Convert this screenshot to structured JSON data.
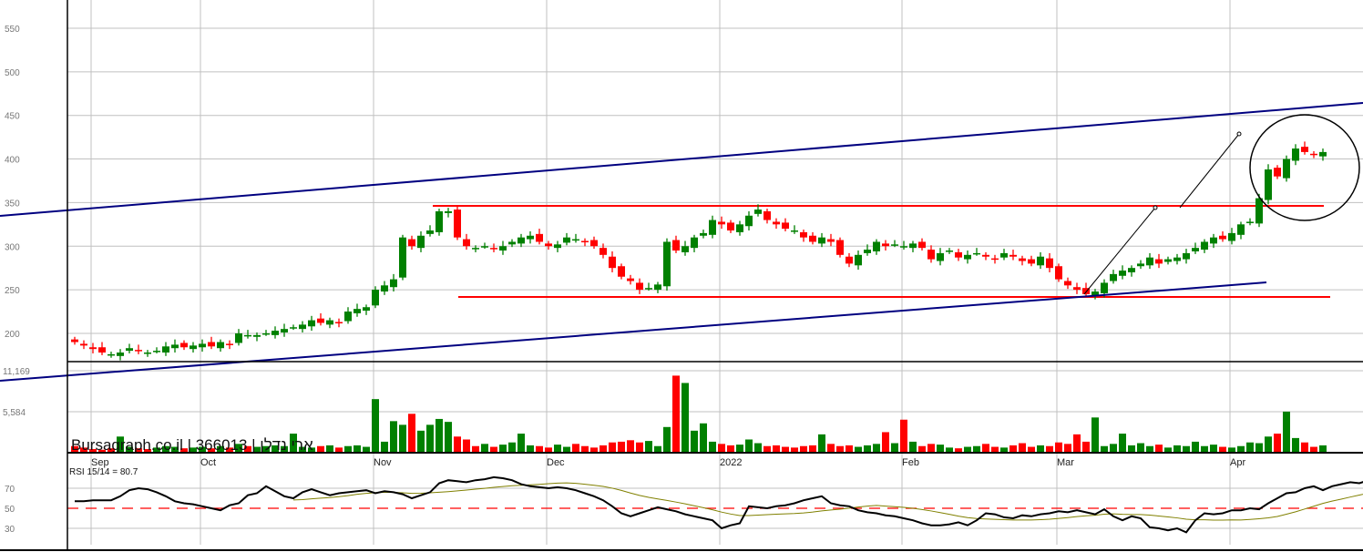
{
  "watermark": "Bursagraph.co.il | 366013 | ארי נדלן",
  "colors": {
    "up": "#008000",
    "down": "#ff0000",
    "trend": "#000080",
    "level": "#ff0000",
    "rsi": "#000000",
    "rsi_signal": "#808000",
    "grid": "#c0c0c0"
  },
  "chart_data": [
    {
      "type": "candlestick",
      "title": "",
      "y_ticks": [
        "550",
        "500",
        "450",
        "400",
        "350",
        "300",
        "250",
        "200"
      ],
      "y_tick_values": [
        550,
        500,
        450,
        400,
        350,
        300,
        250,
        200
      ],
      "ylim": [
        170,
        580
      ],
      "months": [
        {
          "label": "Sep",
          "index": 2
        },
        {
          "label": "Oct",
          "index": 14
        },
        {
          "label": "Nov",
          "index": 33
        },
        {
          "label": "Dec",
          "index": 52
        },
        {
          "label": "2022",
          "index": 71
        },
        {
          "label": "Feb",
          "index": 91
        },
        {
          "label": "Mar",
          "index": 108
        },
        {
          "label": "Apr",
          "index": 127
        }
      ],
      "close": [
        190,
        186,
        182,
        178,
        176,
        178,
        183,
        180,
        178,
        180,
        185,
        187,
        184,
        186,
        188,
        185,
        190,
        187,
        200,
        198,
        198,
        200,
        203,
        205,
        207,
        210,
        215,
        212,
        215,
        212,
        225,
        228,
        230,
        250,
        255,
        262,
        310,
        300,
        312,
        318,
        340,
        340,
        310,
        300,
        298,
        300,
        297,
        300,
        305,
        310,
        312,
        305,
        300,
        302,
        310,
        308,
        305,
        300,
        290,
        275,
        265,
        260,
        250,
        252,
        256,
        305,
        295,
        300,
        310,
        315,
        330,
        325,
        318,
        325,
        335,
        342,
        330,
        325,
        320,
        318,
        310,
        305,
        310,
        305,
        290,
        280,
        290,
        296,
        305,
        300,
        302,
        300,
        303,
        298,
        285,
        292,
        295,
        287,
        290,
        292,
        288,
        285,
        292,
        288,
        283,
        280,
        288,
        275,
        262,
        255,
        250,
        245,
        248,
        258,
        268,
        272,
        275,
        280,
        287,
        280,
        285,
        287,
        292,
        298,
        305,
        310,
        308,
        315,
        325,
        328,
        355,
        388,
        380,
        400,
        412,
        408,
        405,
        408
      ],
      "levels": {
        "resistance": 346,
        "support": 243
      }
    },
    {
      "type": "bar",
      "title": "Volume",
      "y_ticks": [
        "11,169",
        "5,584"
      ],
      "y_tick_values": [
        11169,
        5584
      ],
      "volume": [
        900,
        700,
        500,
        400,
        600,
        2200,
        800,
        600,
        500,
        700,
        900,
        800,
        600,
        700,
        800,
        600,
        900,
        700,
        1200,
        900,
        800,
        900,
        1000,
        900,
        2600,
        800,
        700,
        900,
        1000,
        700,
        900,
        1000,
        800,
        7300,
        1500,
        4300,
        3800,
        5300,
        3000,
        3800,
        4600,
        4200,
        2200,
        1800,
        900,
        1200,
        800,
        1100,
        1400,
        2600,
        1000,
        900,
        700,
        1100,
        800,
        1200,
        900,
        700,
        1000,
        1400,
        1500,
        1700,
        1400,
        1600,
        900,
        3500,
        10500,
        9500,
        3000,
        4000,
        1500,
        1200,
        1000,
        1100,
        1800,
        1300,
        900,
        1000,
        800,
        700,
        900,
        1000,
        2500,
        1200,
        900,
        1000,
        800,
        1000,
        1200,
        2800,
        1300,
        4500,
        1500,
        900,
        1200,
        1100,
        700,
        600,
        800,
        900,
        1200,
        800,
        700,
        1000,
        1300,
        800,
        1000,
        900,
        1400,
        1200,
        2500,
        1500,
        4800,
        900,
        1200,
        2600,
        1000,
        1300,
        900,
        1100,
        700,
        1000,
        900,
        1500,
        900,
        1100,
        800,
        700,
        900,
        1400,
        1300,
        2200,
        2600,
        5600,
        2000,
        1400,
        800,
        1000
      ],
      "ylim": [
        0,
        11169
      ]
    },
    {
      "type": "line",
      "title": "RSI 15/14 = 80.7",
      "y_ticks": [
        "70",
        "50",
        "30"
      ],
      "y_tick_values": [
        70,
        50,
        30
      ],
      "reference_line": 50,
      "rsi": [
        57,
        57,
        58,
        58,
        58,
        62,
        68,
        70,
        69,
        66,
        62,
        57,
        55,
        54,
        52,
        50,
        48,
        53,
        55,
        63,
        65,
        72,
        67,
        62,
        60,
        66,
        69,
        66,
        63,
        65,
        66,
        67,
        68,
        65,
        67,
        66,
        64,
        60,
        63,
        66,
        75,
        78,
        77,
        76,
        78,
        79,
        81,
        80,
        78,
        74,
        72,
        71,
        70,
        71,
        70,
        68,
        65,
        62,
        58,
        52,
        45,
        42,
        45,
        48,
        51,
        49,
        47,
        44,
        42,
        40,
        38,
        30,
        33,
        35,
        52,
        51,
        50,
        52,
        53,
        55,
        58,
        60,
        62,
        55,
        53,
        52,
        48,
        46,
        45,
        43,
        42,
        40,
        38,
        35,
        33,
        33,
        34,
        36,
        33,
        38,
        45,
        44,
        41,
        40,
        43,
        42,
        44,
        45,
        47,
        46,
        48,
        46,
        44,
        49,
        42,
        38,
        42,
        40,
        31,
        30,
        28,
        30,
        26,
        38,
        45,
        44,
        45,
        48,
        48,
        50,
        49,
        55,
        60,
        65,
        66,
        70,
        72,
        68,
        72,
        74,
        76,
        75,
        78,
        82,
        80,
        81,
        80,
        80
      ],
      "ylim": [
        10,
        100
      ]
    }
  ]
}
